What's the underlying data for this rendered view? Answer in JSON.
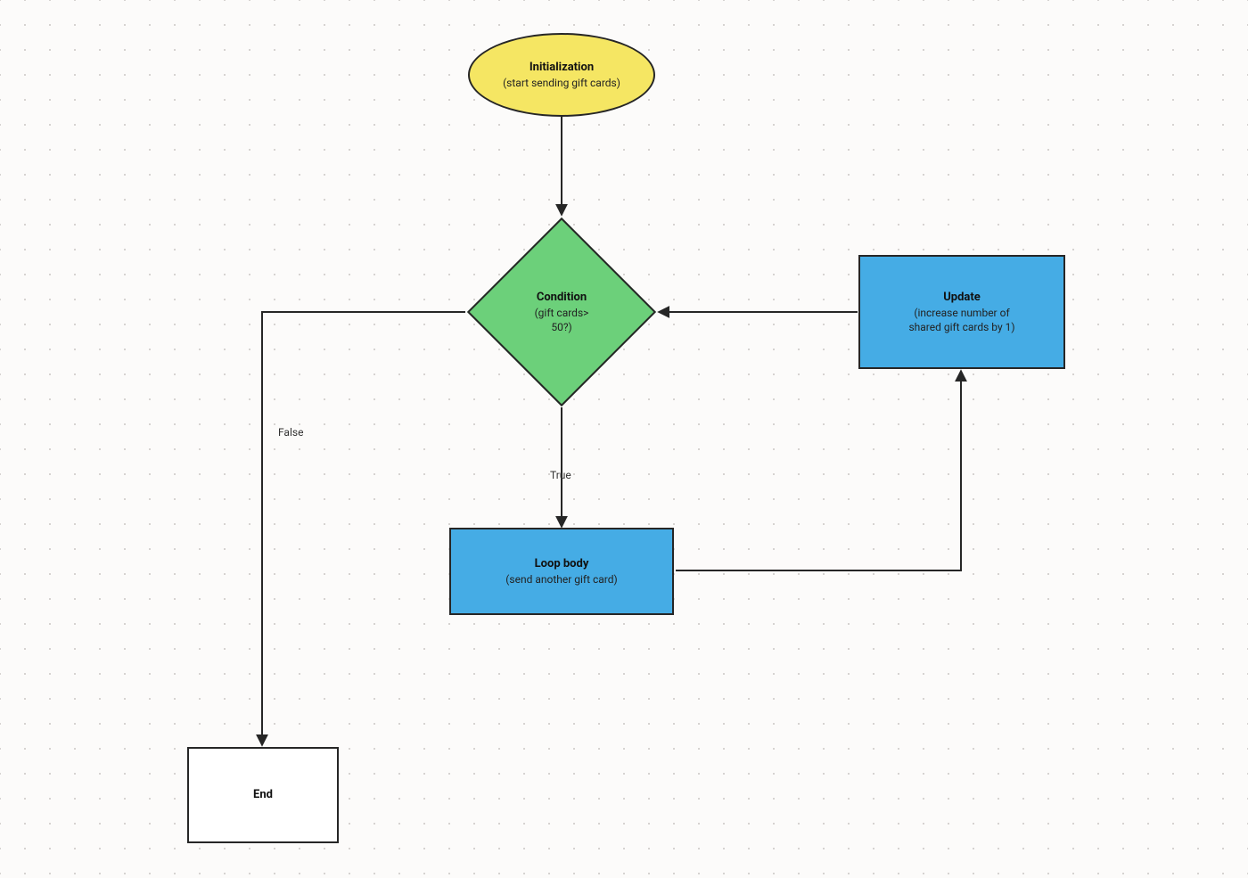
{
  "nodes": {
    "init": {
      "title": "Initialization",
      "sub": "(start sending gift cards)"
    },
    "condition": {
      "title": "Condition",
      "sub1": "(gift cards>",
      "sub2": "50?)"
    },
    "loop": {
      "title": "Loop body",
      "sub": "(send another gift card)"
    },
    "update": {
      "title": "Update",
      "sub1": "(increase number of",
      "sub2": "shared gift cards by 1)"
    },
    "end": {
      "title": "End"
    }
  },
  "edgeLabels": {
    "falsePath": "False",
    "truePath": "True"
  },
  "colors": {
    "start": "#f5e663",
    "decision": "#6cd07a",
    "process": "#45ace5",
    "terminal": "#ffffff",
    "stroke": "#262626"
  }
}
